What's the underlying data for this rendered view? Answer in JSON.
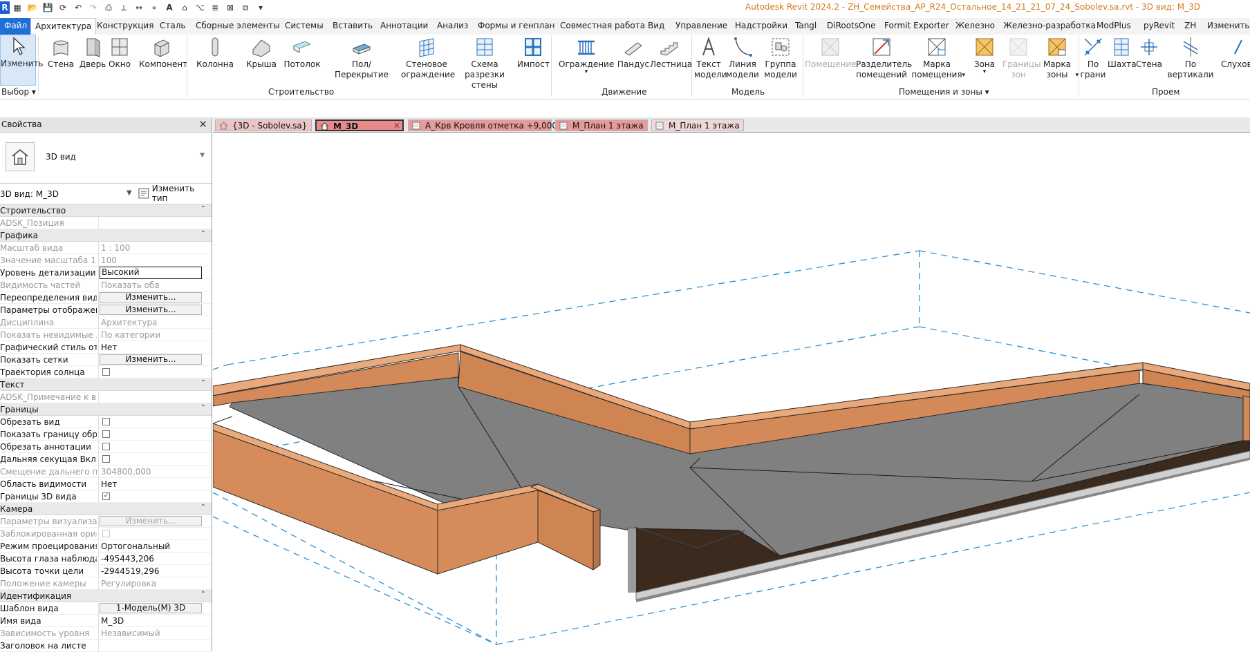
{
  "title": "Autodesk Revit 2024.2 - ZH_Семейства_АР_R24_Остальное_14_21_21_07_24_Sobolev.sa.rvt - 3D вид: M_3D",
  "app_logo": "R",
  "menu": {
    "file": "Файл",
    "tabs": [
      "Архитектура",
      "Конструкция",
      "Сталь",
      "Сборные элементы",
      "Системы",
      "Вставить",
      "Аннотации",
      "Анализ",
      "Формы и генплан",
      "Совместная работа",
      "Вид",
      "Управление",
      "Надстройки",
      "Tangl",
      "DiRootsOne",
      "Formit Exporter",
      "Железно",
      "Железно-разработка",
      "ModPlus",
      "pyRevit",
      "ZH",
      "Изменить"
    ]
  },
  "ribbon": {
    "modify": {
      "line1": "Изменить",
      "group": "Выбор"
    },
    "build": [
      "Стена",
      "Дверь",
      "Окно",
      "Компонент",
      "Колонна",
      "Крыша",
      "Потолок",
      "Пол/Перекрытие"
    ],
    "build2": [
      [
        "Стеновое",
        "ограждение"
      ],
      [
        "Схема разрезки",
        "стены"
      ],
      [
        "Импост"
      ]
    ],
    "build_group": "Строительство",
    "circulation": [
      "Ограждение",
      "Пандус",
      "Лестница"
    ],
    "circulation_group": "Движение",
    "model": [
      [
        "Текст",
        "модели"
      ],
      [
        "Линия",
        "модели"
      ],
      [
        "Группа",
        "модели"
      ]
    ],
    "model_group": "Модель",
    "room_area": [
      [
        "Помещение",
        ""
      ],
      [
        "Разделитель",
        "помещений"
      ],
      [
        "Марка",
        "помещения"
      ],
      [
        "Зона",
        ""
      ],
      [
        "Границы",
        "зон"
      ],
      [
        "Марка",
        "зоны"
      ]
    ],
    "room_group": "Помещения и зоны",
    "opening": [
      [
        "По",
        "грани"
      ],
      [
        "Шахта",
        ""
      ],
      [
        "Стена",
        ""
      ],
      [
        "По вертикали",
        ""
      ],
      [
        "Слухове",
        ""
      ]
    ],
    "opening_group": "Проем"
  },
  "doc_tabs": [
    "{3D - Sobolev.sa}",
    "M_3D",
    "А_Крв Кровля отметка +9,000",
    "М_План 1 этажа",
    "М_План 1 этажа"
  ],
  "properties": {
    "header": "Свойства",
    "type_name": "3D вид",
    "instance": "3D вид: M_3D",
    "edit_type": "Изменить тип",
    "rows": [
      {
        "kind": "cat",
        "name": "Строительство"
      },
      {
        "kind": "prop",
        "name": "ADSK_Позиция",
        "value": "",
        "grey": true
      },
      {
        "kind": "cat",
        "name": "Графика"
      },
      {
        "kind": "prop",
        "name": "Масштаб вида",
        "value": "1 : 100",
        "grey": true
      },
      {
        "kind": "prop",
        "name": "Значение масштаба    1:",
        "value": "100",
        "grey": true
      },
      {
        "kind": "input",
        "name": "Уровень детализации",
        "value": "Высокий"
      },
      {
        "kind": "prop",
        "name": "Видимость частей",
        "value": "Показать оба",
        "grey": true
      },
      {
        "kind": "button",
        "name": "Переопределения види...",
        "value": "Изменить..."
      },
      {
        "kind": "button",
        "name": "Параметры отображен...",
        "value": "Изменить..."
      },
      {
        "kind": "prop",
        "name": "Дисциплина",
        "value": "Архитектура",
        "grey": true
      },
      {
        "kind": "prop",
        "name": "Показать невидимые л...",
        "value": "По категории",
        "grey": true
      },
      {
        "kind": "prop",
        "name": "Графический стиль ото...",
        "value": "Нет"
      },
      {
        "kind": "button",
        "name": "Показать сетки",
        "value": "Изменить..."
      },
      {
        "kind": "check",
        "name": "Траектория солнца",
        "checked": false
      },
      {
        "kind": "cat",
        "name": "Текст"
      },
      {
        "kind": "prop",
        "name": "ADSK_Примечание к виду",
        "value": "",
        "grey": true
      },
      {
        "kind": "cat",
        "name": "Границы"
      },
      {
        "kind": "check",
        "name": "Обрезать вид",
        "checked": false
      },
      {
        "kind": "check",
        "name": "Показать границу обре...",
        "checked": false
      },
      {
        "kind": "check",
        "name": "Обрезать аннотации",
        "checked": false
      },
      {
        "kind": "check",
        "name": "Дальняя секущая Вкл",
        "checked": false
      },
      {
        "kind": "prop",
        "name": "Смещение дальнего пр...",
        "value": "304800,000",
        "grey": true
      },
      {
        "kind": "prop",
        "name": "Область видимости",
        "value": "Нет"
      },
      {
        "kind": "check",
        "name": "Границы 3D вида",
        "checked": true
      },
      {
        "kind": "cat",
        "name": "Камера"
      },
      {
        "kind": "button",
        "name": "Параметры визуализац...",
        "value": "Изменить...",
        "grey": true
      },
      {
        "kind": "check",
        "name": "Заблокированная орие...",
        "checked": false,
        "grey": true
      },
      {
        "kind": "prop",
        "name": "Режим проецирования",
        "value": "Ортогональный"
      },
      {
        "kind": "prop",
        "name": "Высота глаза наблюдат...",
        "value": "-495443,206"
      },
      {
        "kind": "prop",
        "name": "Высота точки цели",
        "value": "-2944519,296"
      },
      {
        "kind": "prop",
        "name": "Положение камеры",
        "value": "Регулировка",
        "grey": true
      },
      {
        "kind": "cat",
        "name": "Идентификация"
      },
      {
        "kind": "button",
        "name": "Шаблон вида",
        "value": "1-Модель(М) 3D"
      },
      {
        "kind": "prop",
        "name": "Имя вида",
        "value": "M_3D"
      },
      {
        "kind": "prop",
        "name": "Зависимость уровня",
        "value": "Независимый",
        "grey": true
      },
      {
        "kind": "prop",
        "name": "Заголовок на листе",
        "value": ""
      }
    ]
  },
  "colors": {
    "title": "#d27a1e",
    "file_tab": "#1e6fd6",
    "parapet_front": "#d68c5a",
    "parapet_top": "#e8a878",
    "roof": "#7f7f7f",
    "section_box": "#2b8fd0"
  }
}
